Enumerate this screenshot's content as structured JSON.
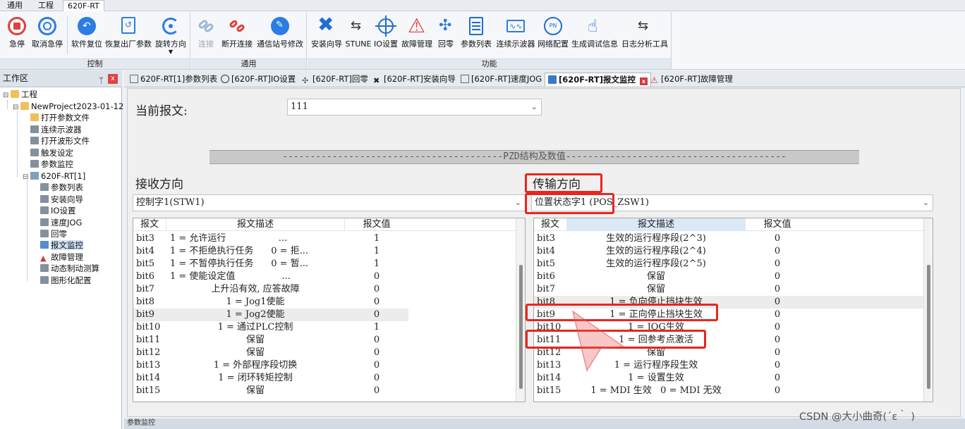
{
  "menu": {
    "tabs": [
      "通用",
      "工程",
      "620F-RT"
    ]
  },
  "ribbon": {
    "groups": [
      {
        "title": "控制",
        "buttons": [
          {
            "label": "急停",
            "icon": "stop-icon",
            "color": "#e0413a"
          },
          {
            "label": "取消急停",
            "icon": "cancel-stop-icon",
            "color": "#2a7de1"
          },
          {
            "label": "软件复位",
            "icon": "undo-icon",
            "color": "#2a7de1"
          },
          {
            "label": "恢复出厂参数",
            "icon": "factory-reset-icon",
            "color": "#2a7de1"
          },
          {
            "label": "旋转方向",
            "icon": "rotate-icon",
            "color": "#2a7de1",
            "dropdown": "▼"
          }
        ]
      },
      {
        "title": "通用",
        "buttons": [
          {
            "label": "连接",
            "icon": "link-icon",
            "color": "#9fb8d4"
          },
          {
            "label": "断开连接",
            "icon": "unlink-icon",
            "color": "#e0413a"
          },
          {
            "label": "通信站号修改",
            "icon": "edit-icon",
            "color": "#2a7de1"
          }
        ]
      },
      {
        "title": "功能",
        "buttons": [
          {
            "label": "安装向导",
            "icon": "wrench-icon",
            "color": "#1f6ed4"
          },
          {
            "label": "STUNE",
            "icon": "tune-icon",
            "color": "#333333"
          },
          {
            "label": "IO设置",
            "icon": "crosshair-icon",
            "color": "#1f6ed4"
          },
          {
            "label": "故障管理",
            "icon": "warning-icon",
            "color": "#e0413a"
          },
          {
            "label": "回零",
            "icon": "home-icon",
            "color": "#2a7de1"
          },
          {
            "label": "参数列表",
            "icon": "list-icon",
            "color": "#1f6ed4"
          },
          {
            "label": "连续示波器",
            "icon": "oscilloscope-icon",
            "color": "#2a7de1"
          },
          {
            "label": "网络配置",
            "icon": "network-icon",
            "color": "#1f6ed4"
          },
          {
            "label": "生成调试信息",
            "icon": "hand-icon",
            "color": "#1f6ed4"
          },
          {
            "label": "日志分析工具",
            "icon": "log-icon",
            "color": "#333333"
          }
        ]
      }
    ]
  },
  "workpanel": {
    "title": "工作区",
    "pin": "ᛘ",
    "close": "x",
    "tree": [
      {
        "label": "工程",
        "icon": "folder-icon",
        "level": 0,
        "expander": "⊟"
      },
      {
        "label": "NewProject2023-01-12",
        "icon": "folder-open-icon",
        "level": 1,
        "expander": "⊟"
      },
      {
        "label": "打开参数文件",
        "icon": "folder-icon",
        "level": 2
      },
      {
        "label": "连续示波器",
        "icon": "oscilloscope-icon",
        "level": 2
      },
      {
        "label": "打开波形文件",
        "icon": "waveform-icon",
        "level": 2
      },
      {
        "label": "触发设定",
        "icon": "trigger-icon",
        "level": 2
      },
      {
        "label": "参数监控",
        "icon": "monitor-icon",
        "level": 2
      },
      {
        "label": "620F-RT[1]",
        "icon": "device-icon",
        "level": 2,
        "expander": "⊟"
      },
      {
        "label": "参数列表",
        "icon": "list-icon",
        "level": 3
      },
      {
        "label": "安装向导",
        "icon": "wrench-icon",
        "level": 3
      },
      {
        "label": "IO设置",
        "icon": "crosshair-icon",
        "level": 3
      },
      {
        "label": "速度JOG",
        "icon": "jog-icon",
        "level": 3
      },
      {
        "label": "回零",
        "icon": "home-icon",
        "level": 3
      },
      {
        "label": "报文监控",
        "icon": "telegram-icon",
        "level": 3,
        "selected": true
      },
      {
        "label": "故障管理",
        "icon": "warning-icon",
        "level": 3
      },
      {
        "label": "动态制动测算",
        "icon": "brake-icon",
        "level": 3
      },
      {
        "label": "图形化配置",
        "icon": "graphic-icon",
        "level": 3
      }
    ]
  },
  "tabs": [
    {
      "label": "620F-RT[1]参数列表",
      "icon": "list-icon"
    },
    {
      "label": "[620F-RT]IO设置",
      "icon": "crosshair-icon"
    },
    {
      "label": "[620F-RT]回零",
      "icon": "home-icon"
    },
    {
      "label": "[620F-RT]安装向导",
      "icon": "wrench-icon"
    },
    {
      "label": "[620F-RT]速度JOG",
      "icon": "jog-icon"
    },
    {
      "label": "[620F-RT]报文监控",
      "icon": "telegram-icon",
      "active": true,
      "close": "x"
    },
    {
      "label": "[620F-RT]故障管理",
      "icon": "warning-icon"
    }
  ],
  "monitor": {
    "current_label": "当前报文:",
    "current_value": "111",
    "combo_arrow": "⌄",
    "divider": "----------------------------------------PZD结构及数值----------------------------------------",
    "receive": {
      "title": "接收方向",
      "selector": "控制字1(STW1)",
      "columns": [
        "报文",
        "报文描述",
        "报文值"
      ],
      "rows": [
        {
          "bit": "bit3",
          "desc": "1 = 允许运行                  ...",
          "val": "1"
        },
        {
          "bit": "bit4",
          "desc": "1 = 不拒绝执行任务      0 = 拒...",
          "val": "1"
        },
        {
          "bit": "bit5",
          "desc": "1 = 不暂停执行任务      0 = 暂...",
          "val": "1"
        },
        {
          "bit": "bit6",
          "desc": "1 = 使能设定值                ...",
          "val": "0"
        },
        {
          "bit": "bit7",
          "desc": "上升沿有效, 应答故障",
          "val": "0"
        },
        {
          "bit": "bit8",
          "desc": "1 = Jog1使能",
          "val": "0"
        },
        {
          "bit": "bit9",
          "desc": "1 = Jog2使能",
          "val": "0",
          "highlight": true
        },
        {
          "bit": "bit10",
          "desc": "1 = 通过PLC控制",
          "val": "1"
        },
        {
          "bit": "bit11",
          "desc": "保留",
          "val": "0"
        },
        {
          "bit": "bit12",
          "desc": "保留",
          "val": "0"
        },
        {
          "bit": "bit13",
          "desc": "1 = 外部程序段切换",
          "val": "0"
        },
        {
          "bit": "bit14",
          "desc": "1 = 闭环转矩控制",
          "val": "0"
        },
        {
          "bit": "bit15",
          "desc": "保留",
          "val": "0"
        }
      ]
    },
    "transmit": {
      "title": "传输方向",
      "selector": "位置状态字1 (POS_ZSW1)",
      "columns": [
        "报文",
        "报文描述",
        "报文值"
      ],
      "rows": [
        {
          "bit": "bit3",
          "desc": "生效的运行程序段(2^3)",
          "val": "0"
        },
        {
          "bit": "bit4",
          "desc": "生效的运行程序段(2^4)",
          "val": "0"
        },
        {
          "bit": "bit5",
          "desc": "生效的运行程序段(2^5)",
          "val": "0"
        },
        {
          "bit": "bit6",
          "desc": "保留",
          "val": "0"
        },
        {
          "bit": "bit7",
          "desc": "保留",
          "val": "0"
        },
        {
          "bit": "bit8",
          "desc": "1 = 负向停止挡块生效",
          "val": "0",
          "highlight": true
        },
        {
          "bit": "bit9",
          "desc": "1 = 正向停止挡块生效",
          "val": "0"
        },
        {
          "bit": "bit10",
          "desc": "1 = JOG生效",
          "val": "0"
        },
        {
          "bit": "bit11",
          "desc": "1 = 回参考点激活",
          "val": "0"
        },
        {
          "bit": "bit12",
          "desc": "保留",
          "val": "0"
        },
        {
          "bit": "bit13",
          "desc": "1 = 运行程序段生效",
          "val": "0"
        },
        {
          "bit": "bit14",
          "desc": "1 = 设置生效",
          "val": "0"
        },
        {
          "bit": "bit15",
          "desc": "1 = MDI 生效   0 = MDI 无效",
          "val": "0"
        }
      ]
    }
  },
  "statusbar": {
    "label": "参数监控"
  },
  "watermark": "CSDN @大小曲奇(´ε｀ )",
  "colors": {
    "annotation_red": "#e8261e",
    "accent_blue": "#2a7de1",
    "selection": "#cfe0f4"
  }
}
